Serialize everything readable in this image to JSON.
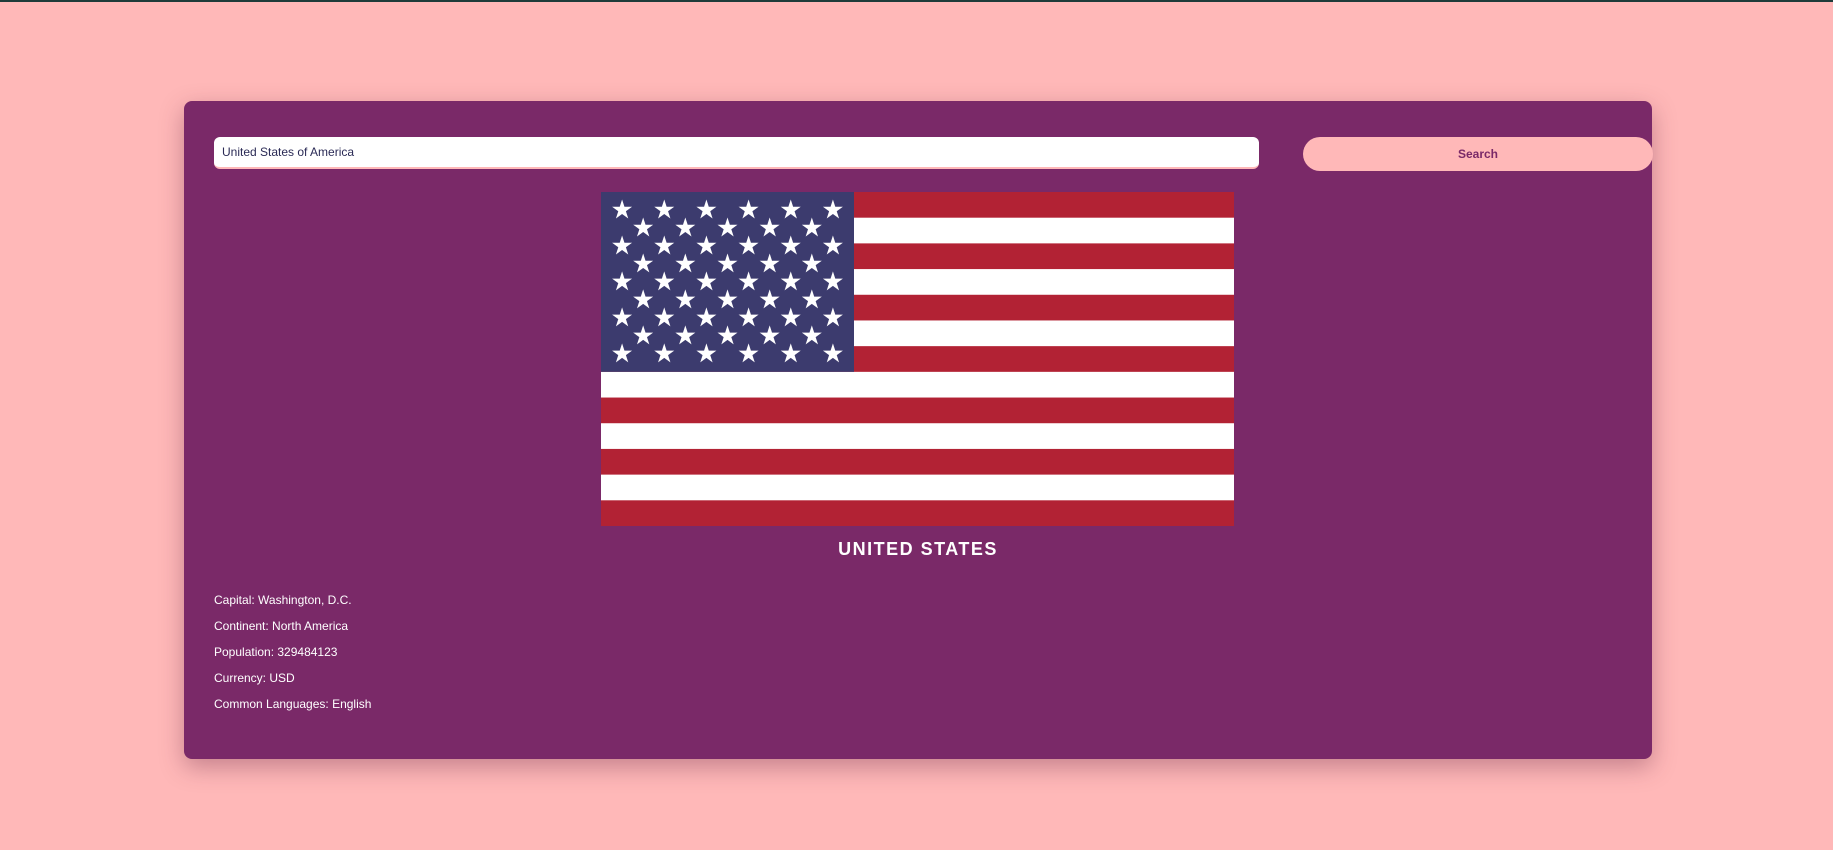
{
  "search": {
    "value": "United States of America",
    "button_label": "Search"
  },
  "country": {
    "name": "UNITED STATES",
    "flag_icon": "us-flag-icon"
  },
  "info": {
    "capital": "Capital: Washington, D.C.",
    "continent": "Continent: North America",
    "population": "Population: 329484123",
    "currency": "Currency: USD",
    "languages": "Common Languages: English"
  },
  "colors": {
    "page_background": "#ffb8b8",
    "card_background": "#7a2968",
    "button_background": "#ffb8b8",
    "flag_red": "#b22234",
    "flag_blue": "#3c3b6e",
    "flag_white": "#ffffff"
  }
}
